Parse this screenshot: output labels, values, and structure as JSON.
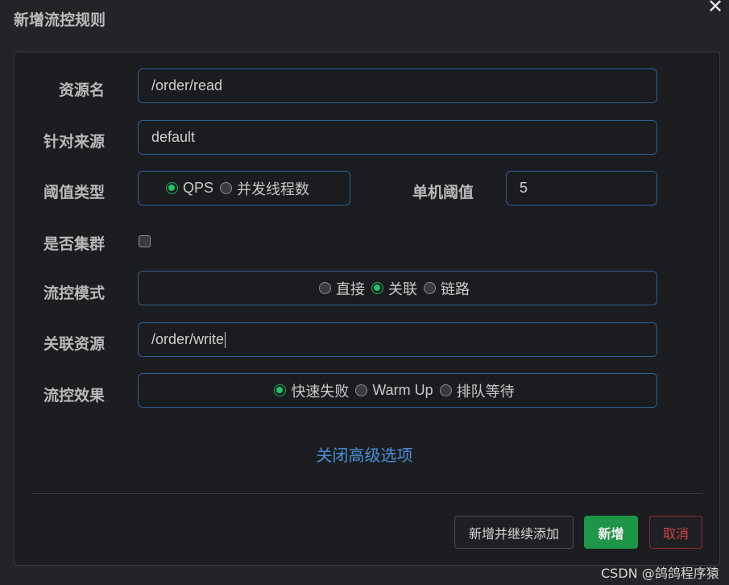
{
  "dialog": {
    "title": "新增流控规则",
    "close_glyph": "✕"
  },
  "form": {
    "resource": {
      "label": "资源名",
      "value": "/order/read"
    },
    "origin": {
      "label": "针对来源",
      "value": "default"
    },
    "threshold_type": {
      "label": "阈值类型",
      "options": [
        "QPS",
        "并发线程数"
      ],
      "selected": "QPS"
    },
    "threshold": {
      "label": "单机阈值",
      "value": "5"
    },
    "cluster": {
      "label": "是否集群",
      "checked": false
    },
    "flow_mode": {
      "label": "流控模式",
      "options": [
        "直接",
        "关联",
        "链路"
      ],
      "selected": "关联"
    },
    "ref_resource": {
      "label": "关联资源",
      "value": "/order/write"
    },
    "effect": {
      "label": "流控效果",
      "options": [
        "快速失败",
        "Warm Up",
        "排队等待"
      ],
      "selected": "快速失败"
    },
    "advanced_link": "关闭高级选项"
  },
  "buttons": {
    "add_continue": "新增并继续添加",
    "add": "新增",
    "cancel": "取消"
  },
  "watermark": "CSDN @鸽鸽程序猿",
  "colors": {
    "accent": "#4b8fd6",
    "primary": "#1f9548",
    "danger": "#d0434a",
    "radio_checked": "#23c46c"
  }
}
